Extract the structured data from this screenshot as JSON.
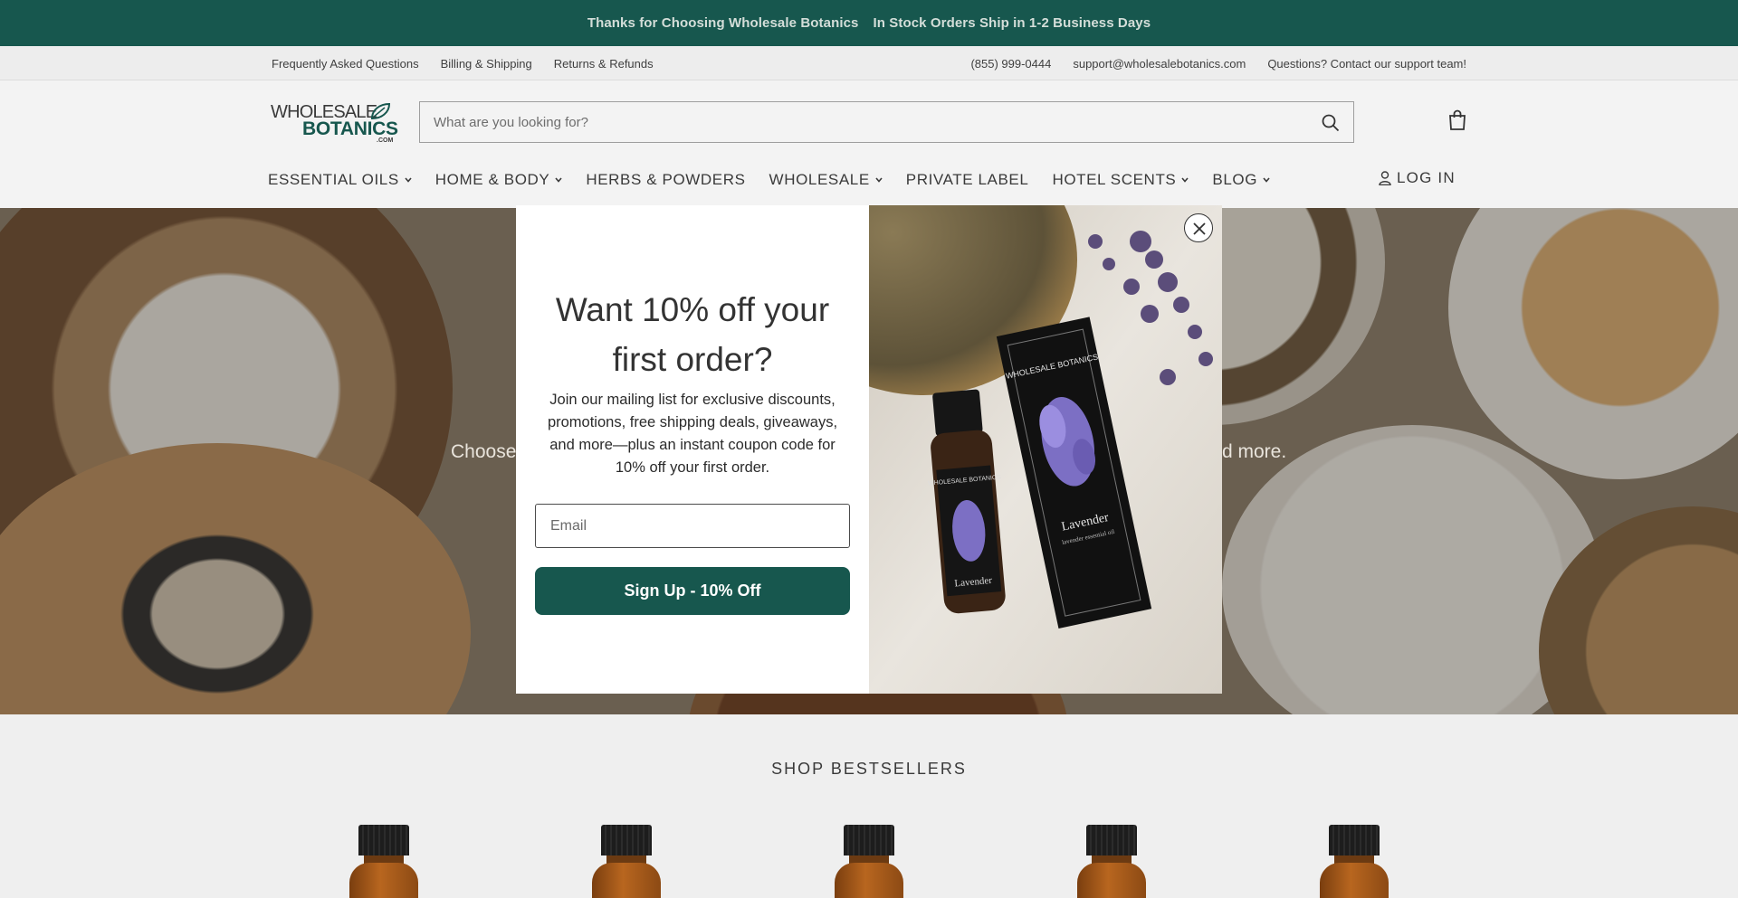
{
  "announcement": {
    "left": "Thanks for Choosing Wholesale Botanics",
    "right": "In Stock Orders Ship in 1-2 Business Days"
  },
  "utility": {
    "left_links": [
      "Frequently Asked Questions",
      "Billing & Shipping",
      "Returns & Refunds"
    ],
    "phone": "(855) 999-0444",
    "email": "support@wholesalebotanics.com",
    "contact": "Questions? Contact our support team!"
  },
  "header": {
    "logo": {
      "line1": "WHOLESALE",
      "line2": "BOTANICS",
      "line3": ".COM"
    },
    "search_placeholder": "What are you looking for?",
    "nav": [
      {
        "label": "ESSENTIAL OILS",
        "dropdown": true
      },
      {
        "label": "HOME & BODY",
        "dropdown": true
      },
      {
        "label": "HERBS & POWDERS",
        "dropdown": false
      },
      {
        "label": "WHOLESALE",
        "dropdown": true
      },
      {
        "label": "PRIVATE LABEL",
        "dropdown": false
      },
      {
        "label": "HOTEL SCENTS",
        "dropdown": true
      },
      {
        "label": "BLOG",
        "dropdown": true
      }
    ],
    "login": "LOG IN"
  },
  "hero": {
    "tagline_left": "Choose",
    "tagline_right": "d more."
  },
  "bestsellers": {
    "title": "SHOP BESTSELLERS"
  },
  "modal": {
    "heading": "Want 10% off your first order?",
    "body": "Join our mailing list for exclusive discounts, promotions, free shipping deals, giveaways, and more—plus an instant coupon code for 10% off your first order.",
    "email_placeholder": "Email",
    "button": "Sign Up - 10% Off",
    "photo": {
      "box_brand": "WHOLESALE BOTANICS",
      "box_name": "Lavender",
      "box_sub": "lavender essential oil",
      "bottle_brand": "WHOLESALE BOTANICS",
      "bottle_name": "Lavender"
    }
  },
  "colors": {
    "brand_green": "#17574e",
    "announcement_text": "#d4ded9"
  }
}
